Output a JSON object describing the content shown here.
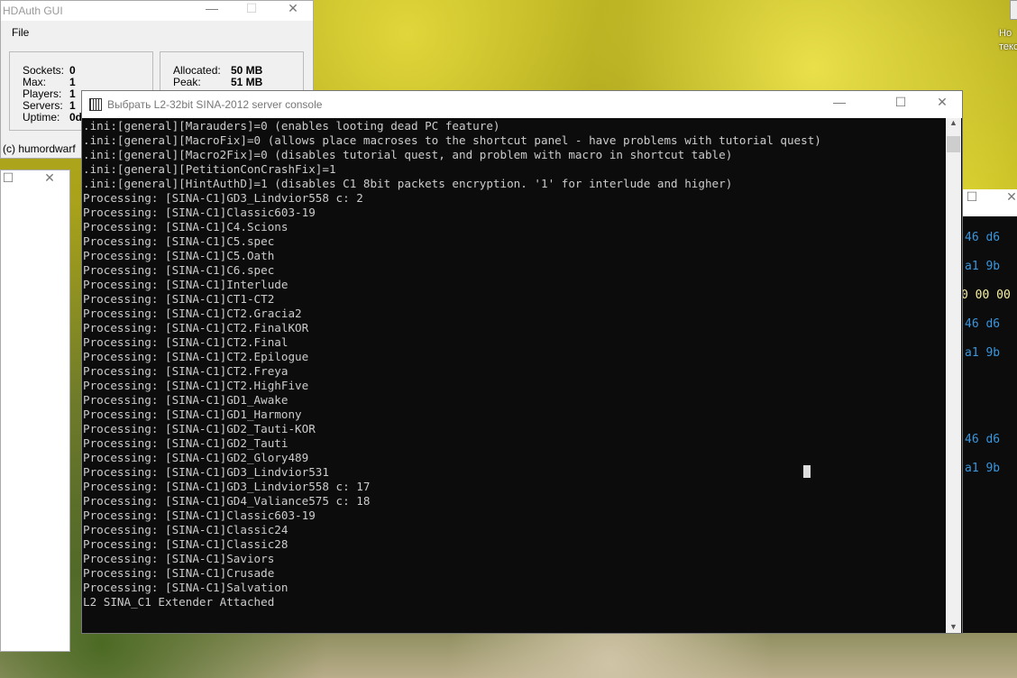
{
  "hdauth": {
    "title": "HDAuth GUI",
    "menu": "File",
    "stats": [
      [
        "Sockets:",
        "0"
      ],
      [
        "Max:",
        "1"
      ],
      [
        "Players:",
        "1"
      ],
      [
        "Servers:",
        "1"
      ],
      [
        "Uptime:",
        "0d"
      ]
    ],
    "memory": [
      [
        "Allocated:",
        "50 MB"
      ],
      [
        "Peak:",
        "51 MB"
      ]
    ],
    "footer": "(c) humordwarf"
  },
  "desktop_icon": {
    "label": "Но\nтекс"
  },
  "console": {
    "title": "Выбрать L2-32bit SINA-2012 server console",
    "lines": [
      ".ini:[general][Marauders]=0 (enables looting dead PC feature)",
      ".ini:[general][MacroFix]=0 (allows place macroses to the shortcut panel - have problems with tutorial quest)",
      ".ini:[general][Macro2Fix]=0 (disables tutorial quest, and problem with macro in shortcut table)",
      ".ini:[general][PetitionConCrashFix]=1",
      ".ini:[general][HintAuthD]=1 (disables C1 8bit packets encryption. '1' for interlude and higher)",
      "Processing: [SINA-C1]GD3_Lindvior558 c: 2",
      "Processing: [SINA-C1]Classic603-19",
      "Processing: [SINA-C1]C4.Scions",
      "Processing: [SINA-C1]C5.spec",
      "Processing: [SINA-C1]C5.Oath",
      "Processing: [SINA-C1]C6.spec",
      "Processing: [SINA-C1]Interlude",
      "Processing: [SINA-C1]CT1-CT2",
      "Processing: [SINA-C1]CT2.Gracia2",
      "Processing: [SINA-C1]CT2.FinalKOR",
      "Processing: [SINA-C1]CT2.Final",
      "Processing: [SINA-C1]CT2.Epilogue",
      "Processing: [SINA-C1]CT2.Freya",
      "Processing: [SINA-C1]CT2.HighFive",
      "Processing: [SINA-C1]GD1_Awake",
      "Processing: [SINA-C1]GD1_Harmony",
      "Processing: [SINA-C1]GD2_Tauti-KOR",
      "Processing: [SINA-C1]GD2_Tauti",
      "Processing: [SINA-C1]GD2_Glory489",
      "Processing: [SINA-C1]GD3_Lindvior531",
      "Processing: [SINA-C1]GD3_Lindvior558 c: 17",
      "Processing: [SINA-C1]GD4_Valiance575 c: 18",
      "Processing: [SINA-C1]Classic603-19",
      "Processing: [SINA-C1]Classic24",
      "Processing: [SINA-C1]Classic28",
      "Processing: [SINA-C1]Saviors",
      "Processing: [SINA-C1]Crusade",
      "Processing: [SINA-C1]Salvation",
      "L2 SINA_C1 Extender Attached"
    ]
  },
  "right_console": {
    "hex": [
      [
        "46 d6",
        "#3a96dd"
      ],
      [
        "a1 9b",
        "#3a96dd"
      ],
      [
        "0 00 00",
        "#f9f1a5"
      ],
      [
        "46 d6",
        "#3a96dd"
      ],
      [
        "a1 9b",
        "#3a96dd"
      ],
      [
        "46 d6",
        "#3a96dd"
      ],
      [
        "a1 9b",
        "#3a96dd"
      ]
    ]
  },
  "controls": {
    "minimize": "—",
    "maximize": "☐",
    "close": "✕"
  }
}
